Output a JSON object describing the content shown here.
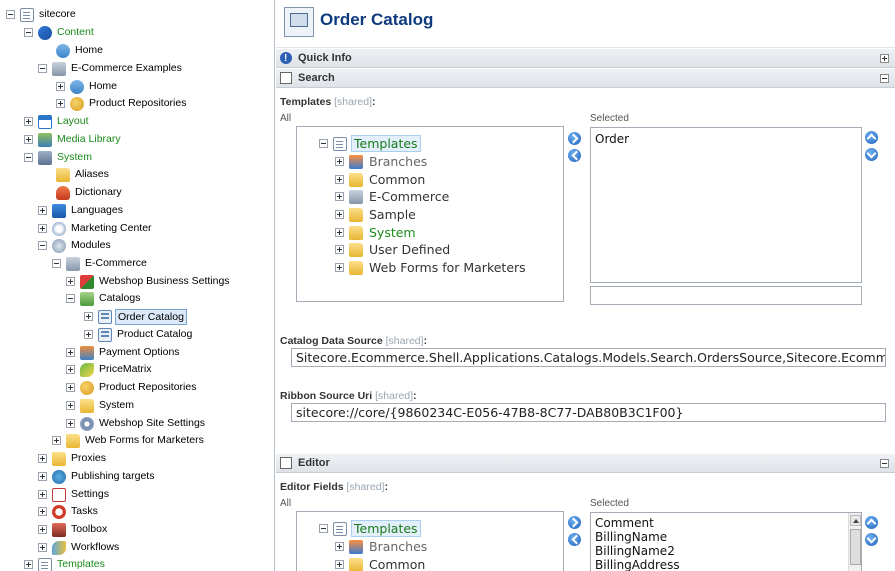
{
  "tree": {
    "items": [
      {
        "label": "sitecore",
        "toggle": "minus",
        "icon": "document-icon"
      },
      {
        "label": "Content",
        "toggle": "minus",
        "icon": "content-icon"
      },
      {
        "label": "Home",
        "toggle": "none",
        "icon": "home-icon"
      },
      {
        "label": "E-Commerce Examples",
        "toggle": "minus",
        "icon": "ecommerce-icon"
      },
      {
        "label": "Home",
        "toggle": "plus",
        "icon": "home-icon"
      },
      {
        "label": "Product Repositories",
        "toggle": "plus",
        "icon": "repository-icon"
      },
      {
        "label": "Layout",
        "toggle": "plus",
        "icon": "layout-icon"
      },
      {
        "label": "Media Library",
        "toggle": "plus",
        "icon": "media-icon"
      },
      {
        "label": "System",
        "toggle": "minus",
        "icon": "system-icon"
      },
      {
        "label": "Aliases",
        "toggle": "none",
        "icon": "folder-icon"
      },
      {
        "label": "Dictionary",
        "toggle": "none",
        "icon": "dictionary-icon"
      },
      {
        "label": "Languages",
        "toggle": "plus",
        "icon": "languages-icon"
      },
      {
        "label": "Marketing Center",
        "toggle": "plus",
        "icon": "marketing-icon"
      },
      {
        "label": "Modules",
        "toggle": "minus",
        "icon": "modules-icon"
      },
      {
        "label": "E-Commerce",
        "toggle": "minus",
        "icon": "ecommerce-icon"
      },
      {
        "label": "Webshop Business Settings",
        "toggle": "plus",
        "icon": "webshop-icon"
      },
      {
        "label": "Catalogs",
        "toggle": "minus",
        "icon": "catalogs-icon"
      },
      {
        "label": "Order Catalog",
        "toggle": "plus",
        "icon": "catalog-form-icon"
      },
      {
        "label": "Product Catalog",
        "toggle": "plus",
        "icon": "catalog-form-icon"
      },
      {
        "label": "Payment Options",
        "toggle": "plus",
        "icon": "payment-icon"
      },
      {
        "label": "PriceMatrix",
        "toggle": "plus",
        "icon": "pricematrix-icon"
      },
      {
        "label": "Product Repositories",
        "toggle": "plus",
        "icon": "repository-icon"
      },
      {
        "label": "System",
        "toggle": "plus",
        "icon": "folder-icon"
      },
      {
        "label": "Webshop Site Settings",
        "toggle": "plus",
        "icon": "gear-icon"
      },
      {
        "label": "Web Forms for Marketers",
        "toggle": "plus",
        "icon": "folder-icon"
      },
      {
        "label": "Proxies",
        "toggle": "plus",
        "icon": "folder-icon"
      },
      {
        "label": "Publishing targets",
        "toggle": "plus",
        "icon": "publishing-icon"
      },
      {
        "label": "Settings",
        "toggle": "plus",
        "icon": "settings-icon"
      },
      {
        "label": "Tasks",
        "toggle": "plus",
        "icon": "tasks-icon"
      },
      {
        "label": "Toolbox",
        "toggle": "plus",
        "icon": "toolbox-icon"
      },
      {
        "label": "Workflows",
        "toggle": "plus",
        "icon": "workflows-icon"
      },
      {
        "label": "Templates",
        "toggle": "plus",
        "icon": "document-icon"
      }
    ]
  },
  "editor": {
    "title": "Order Catalog",
    "quick_info": "Quick Info",
    "search_section": "Search",
    "editor_section": "Editor",
    "templates_field": {
      "label": "Templates",
      "shared": "[shared]",
      "colon": ":",
      "all_label": "All",
      "selected_label": "Selected",
      "tree_items": [
        "Templates",
        "Branches",
        "Common",
        "E-Commerce",
        "Sample",
        "System",
        "User Defined",
        "Web Forms for Marketers"
      ],
      "selected_items": [
        "Order"
      ],
      "filter_value": ""
    },
    "catalog_source": {
      "label": "Catalog Data Source",
      "shared": "[shared]",
      "colon": ":",
      "value": "Sitecore.Ecommerce.Shell.Applications.Catalogs.Models.Search.OrdersSource,Sitecore.Ecomme"
    },
    "ribbon_uri": {
      "label": "Ribbon Source Uri",
      "shared": "[shared]",
      "colon": ":",
      "value": "sitecore://core/{9860234C-E056-47B8-8C77-DAB80B3C1F00}"
    },
    "editor_fields": {
      "label": "Editor Fields",
      "shared": "[shared]",
      "colon": ":",
      "all_label": "All",
      "selected_label": "Selected",
      "tree_items": [
        "Templates",
        "Branches",
        "Common"
      ],
      "selected_items": [
        "Comment",
        "BillingName",
        "BillingName2",
        "BillingAddress"
      ]
    }
  }
}
